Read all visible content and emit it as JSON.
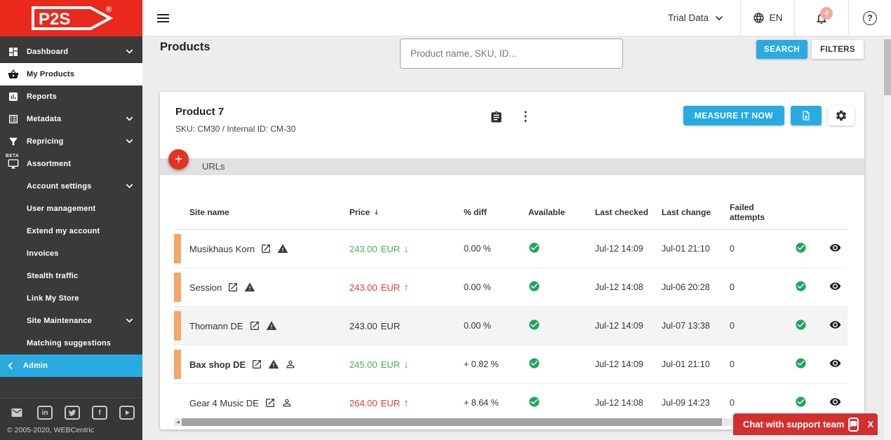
{
  "brand": {
    "logo_text": "P2S",
    "registered_mark": "®"
  },
  "topbar": {
    "account_selector": "Trial Data",
    "language": "EN",
    "notification_badge": "4",
    "help_label": "?"
  },
  "sidebar": {
    "items": [
      {
        "label": "Dashboard",
        "icon": "dashboard-grid",
        "chevron": true
      },
      {
        "label": "My Products",
        "icon": "basket",
        "active": true
      },
      {
        "label": "Reports",
        "icon": "bar-chart"
      },
      {
        "label": "Metadata",
        "icon": "list",
        "chevron": true
      },
      {
        "label": "Repricing",
        "icon": "funnel",
        "chevron": true
      },
      {
        "label": "Assortment",
        "icon": "monitor",
        "badge": "BETA"
      },
      {
        "label": "Account settings",
        "chevron": true
      },
      {
        "label": "User management"
      },
      {
        "label": "Extend my account"
      },
      {
        "label": "Invoices"
      },
      {
        "label": "Stealth traffic"
      },
      {
        "label": "Link My Store"
      },
      {
        "label": "Site Maintenance",
        "chevron": true
      },
      {
        "label": "Matching suggestions"
      },
      {
        "label": "Admin",
        "admin": true
      }
    ],
    "social": [
      "email",
      "linkedin",
      "twitter",
      "facebook",
      "youtube"
    ],
    "copyright": "© 2005-2020, WEBCentric"
  },
  "page": {
    "title": "Products",
    "search_placeholder": "Product name, SKU, ID...",
    "search_button": "SEARCH",
    "filters_button": "FILTERS"
  },
  "product": {
    "name": "Product 7",
    "sku_line": "SKU: CM30 / Internal ID: CM-30",
    "measure_button": "MEASURE IT NOW",
    "urls_section": "URLs"
  },
  "table": {
    "headers": [
      "Site name",
      "Price",
      "% diff",
      "Available",
      "Last checked",
      "Last change",
      "Failed attempts"
    ],
    "price_sort": "desc",
    "rows": [
      {
        "site": "Musikhaus Korn",
        "bold": false,
        "warning": true,
        "person": false,
        "price": "243.00",
        "currency": "EUR",
        "trend": "down",
        "diff": "0.00 %",
        "available": true,
        "last_checked": "Jul-12 14:09",
        "last_change": "Jul-01 21:10",
        "failed_attempts": "0",
        "status_ok": true,
        "accent_bar": true,
        "highlighted": false
      },
      {
        "site": "Session",
        "bold": false,
        "warning": true,
        "person": false,
        "price": "243.00",
        "currency": "EUR",
        "trend": "up",
        "diff": "0.00 %",
        "available": true,
        "last_checked": "Jul-12 14:08",
        "last_change": "Jul-06 20:28",
        "failed_attempts": "0",
        "status_ok": true,
        "accent_bar": true,
        "highlighted": false
      },
      {
        "site": "Thomann DE",
        "bold": false,
        "warning": true,
        "person": false,
        "price": "243.00",
        "currency": "EUR",
        "trend": "none",
        "diff": "0.00 %",
        "available": true,
        "last_checked": "Jul-12 14:09",
        "last_change": "Jul-07 13:38",
        "failed_attempts": "0",
        "status_ok": true,
        "accent_bar": true,
        "highlighted": true
      },
      {
        "site": "Bax shop DE",
        "bold": true,
        "warning": true,
        "person": true,
        "price": "245.00",
        "currency": "EUR",
        "trend": "down",
        "diff": "+ 0.82 %",
        "available": true,
        "last_checked": "Jul-12 14:09",
        "last_change": "Jul-01 21:10",
        "failed_attempts": "0",
        "status_ok": true,
        "accent_bar": true,
        "highlighted": false
      },
      {
        "site": "Gear 4 Music DE",
        "bold": false,
        "warning": false,
        "person": true,
        "price": "264.00",
        "currency": "EUR",
        "trend": "up",
        "diff": "+ 8.64 %",
        "available": true,
        "last_checked": "Jul-12 14:08",
        "last_change": "Jul-09 14:23",
        "failed_attempts": "0",
        "status_ok": true,
        "accent_bar": false,
        "highlighted": false
      }
    ]
  },
  "chat": {
    "label": "Chat with support team",
    "close_label": "X"
  },
  "colors": {
    "accent": "#29abe2",
    "brand_red": "#e8291c",
    "green": "#22a45d",
    "price_up": "#e53935",
    "price_down": "#4caf50",
    "orange": "#f3a768",
    "chat_red": "#d32f2f"
  }
}
